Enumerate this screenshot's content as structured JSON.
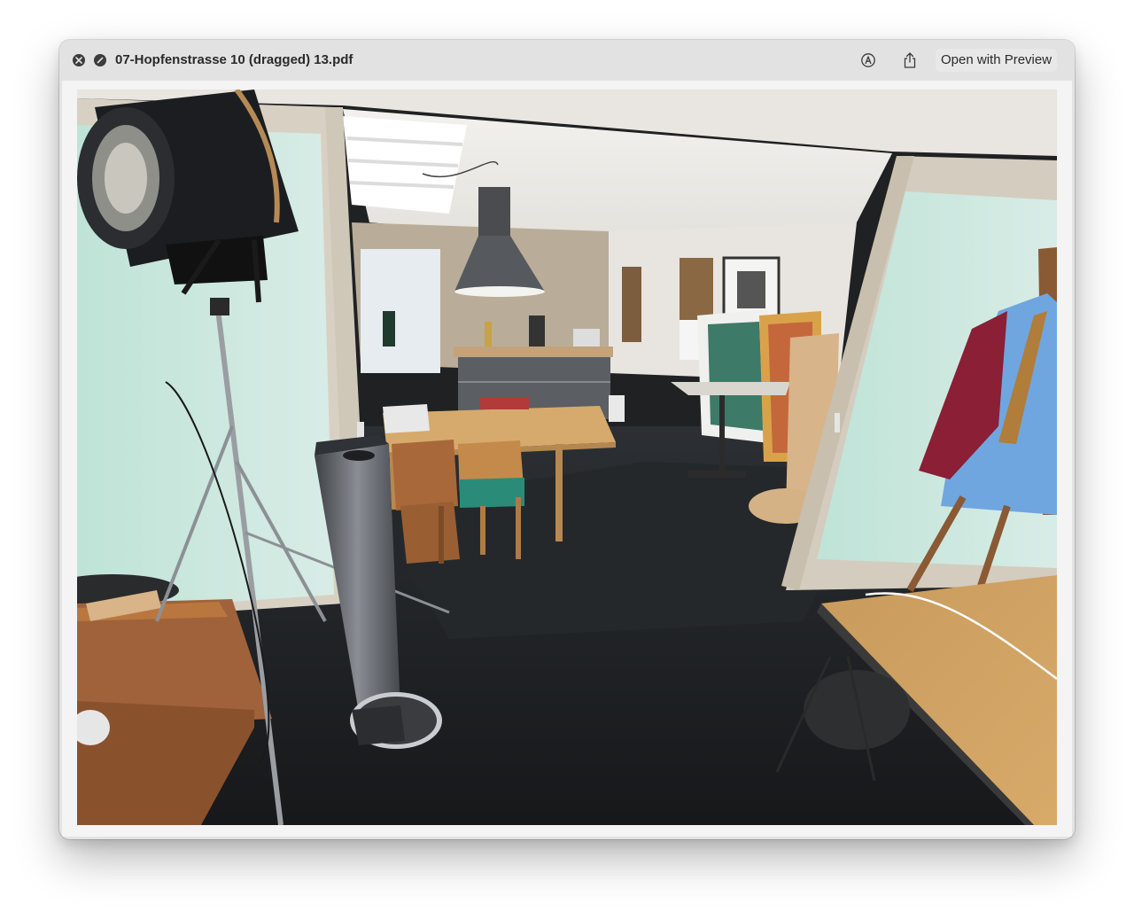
{
  "window": {
    "title": "07-Hopfenstrasse 10 (dragged) 13.pdf",
    "open_with_label": "Open with Preview",
    "controls": {
      "close_icon": "close-icon",
      "fullscreen_icon": "fullscreen-icon",
      "markup_icon": "markup-icon",
      "share_icon": "share-icon"
    }
  },
  "document": {
    "kind": "photo",
    "scene": "office-interior"
  },
  "colors": {
    "titlebar_bg": "#e2e2e2",
    "title_text": "#2a2a2a",
    "control_fill": "#3c3c3c"
  }
}
